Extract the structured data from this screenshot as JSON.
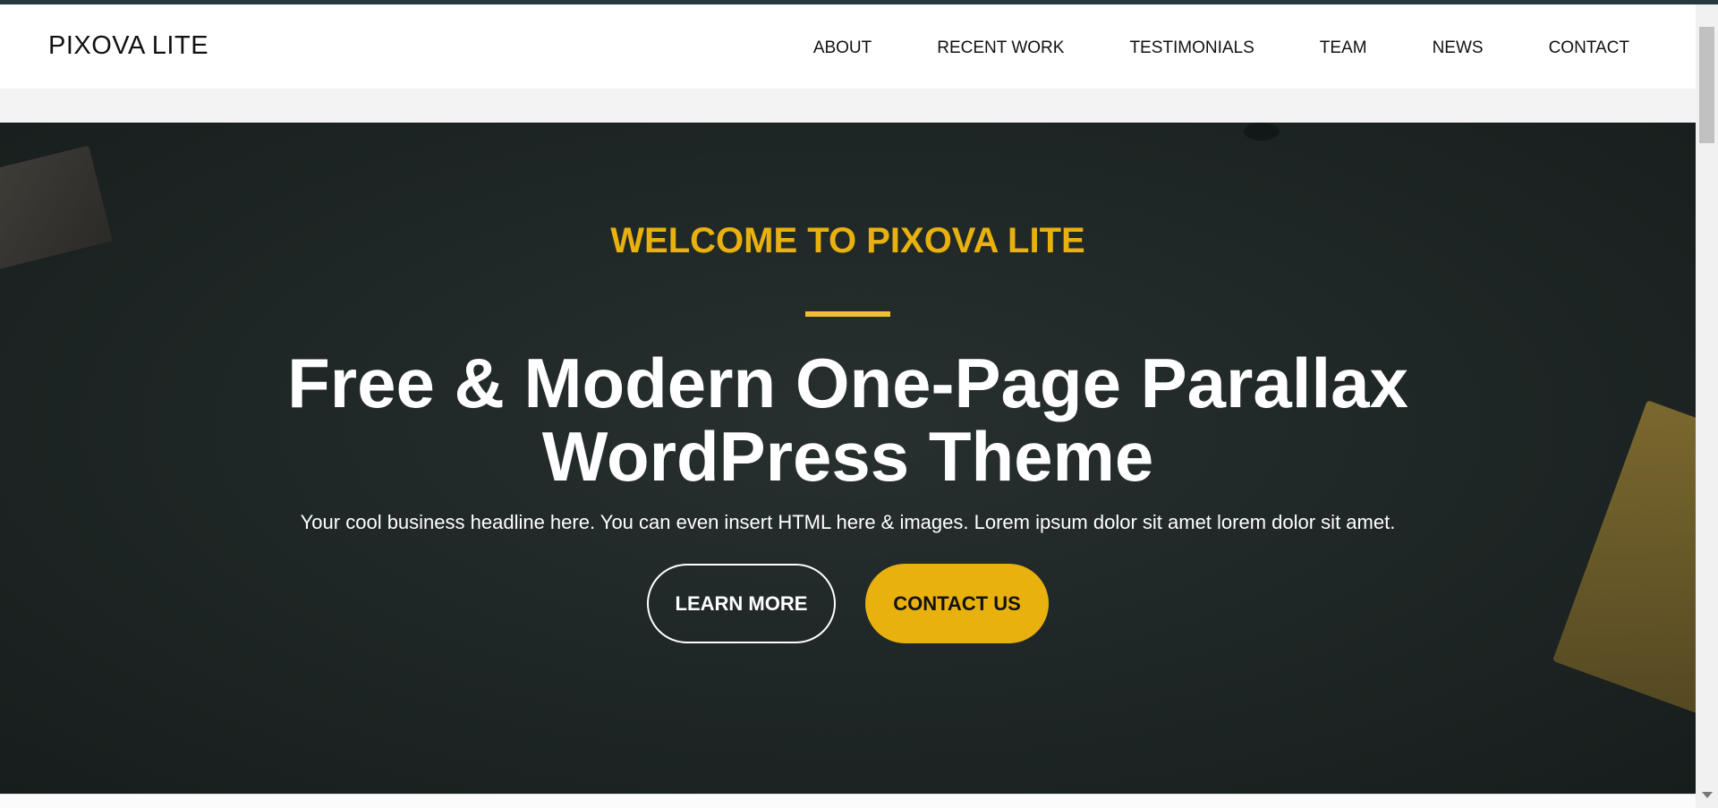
{
  "header": {
    "logo": "PIXOVA LITE",
    "nav": [
      "ABOUT",
      "RECENT WORK",
      "TESTIMONIALS",
      "TEAM",
      "NEWS",
      "CONTACT"
    ]
  },
  "hero": {
    "kicker": "WELCOME TO PIXOVA LITE",
    "title_line1": "Free & Modern One-Page Parallax",
    "title_line2": "WordPress Theme",
    "subtitle": "Your cool business headline here. You can even insert HTML here & images. Lorem ipsum dolor sit amet lorem dolor sit amet.",
    "learn_more_label": "LEARN MORE",
    "contact_us_label": "CONTACT US"
  },
  "colors": {
    "accent": "#e8b10e",
    "hero_bg": "#1e2625",
    "header_bg": "#ffffff"
  }
}
